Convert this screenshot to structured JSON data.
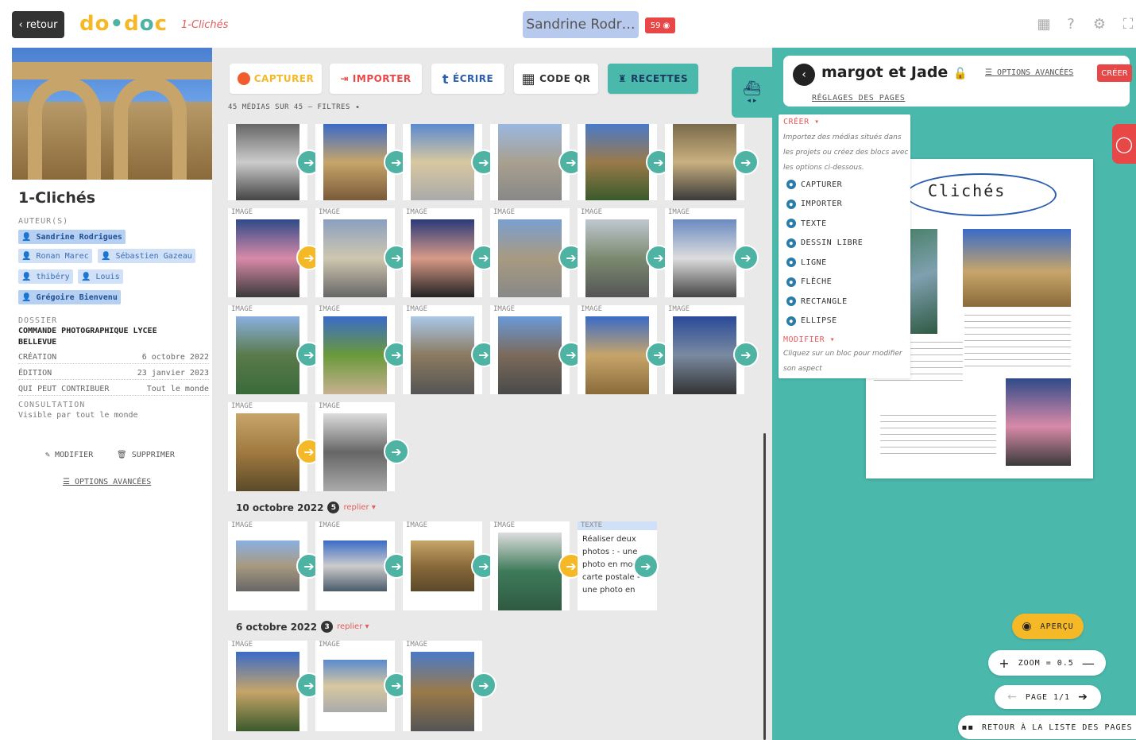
{
  "topbar": {
    "back": "‹ retour",
    "logo": "do•doc",
    "crumb": "1-Clichés",
    "user": "Sandrine Rodr…",
    "notif": "59"
  },
  "project": {
    "title": "1-Clichés",
    "authors_label": "AUTEUR(S)",
    "authors": [
      "Sandrine Rodrigues",
      "Ronan Marec",
      "Sébastien Gazeau",
      "thibéry",
      "Louis",
      "Grégoire Bienvenu"
    ],
    "folder_label": "DOSSIER",
    "folder": "COMMANDE PHOTOGRAPHIQUE LYCEE BELLEVUE",
    "creation_label": "CRÉATION",
    "creation": "6 octobre 2022",
    "edit_label": "ÉDITION",
    "edit": "23 janvier 2023",
    "contrib_label": "QUI PEUT CONTRIBUER",
    "contrib": "Tout le monde",
    "consult_label": "CONSULTATION",
    "consult": "Visible par tout le monde",
    "modify": "MODIFIER",
    "delete": "SUPPRIMER",
    "advanced": "OPTIONS AVANCÉES"
  },
  "toolbar": {
    "capture": "CAPTURER",
    "import": "IMPORTER",
    "write": "ÉCRIRE",
    "qr": "CODE QR",
    "recipes": "RECETTES"
  },
  "media": {
    "count": "45 MÉDIAS SUR 45 — FILTRES ◂",
    "image_label": "IMAGE",
    "text_label": "TEXTE",
    "text_card": "Réaliser deux photos : - une photo en mode carte postale - une photo en",
    "group1": {
      "date": "10 octobre 2022",
      "n": "5",
      "fold": "replier ▾"
    },
    "group2": {
      "date": "6 octobre 2022",
      "n": "3",
      "fold": "replier ▾"
    }
  },
  "editor": {
    "title": "margot et Jade",
    "advanced": "OPTIONS AVANCÉES",
    "create": "CRÉER",
    "settings": "RÉGLAGES DES PAGES",
    "menu_create": "CRÉER ▾",
    "menu_desc": "Importez des médias situés dans les projets ou créez des blocs avec les options ci-dessous.",
    "menu_items": [
      "CAPTURER",
      "IMPORTER",
      "TEXTE",
      "DESSIN LIBRE",
      "LIGNE",
      "FLÈCHE",
      "RECTANGLE",
      "ELLIPSE"
    ],
    "menu_modify": "MODIFIER ▾",
    "menu_modify_desc": "Cliquez sur un bloc pour modifier son aspect",
    "page_title": "Clichés",
    "preview": "APERÇU",
    "zoom": "ZOOM = 0.5",
    "page": "PAGE 1/1",
    "back_pages": "RETOUR À LA LISTE DES PAGES"
  },
  "colors": {
    "teal": "#4bb8ac",
    "yellow": "#f5b827",
    "red": "#e84747",
    "green": "#4fb3a4"
  }
}
